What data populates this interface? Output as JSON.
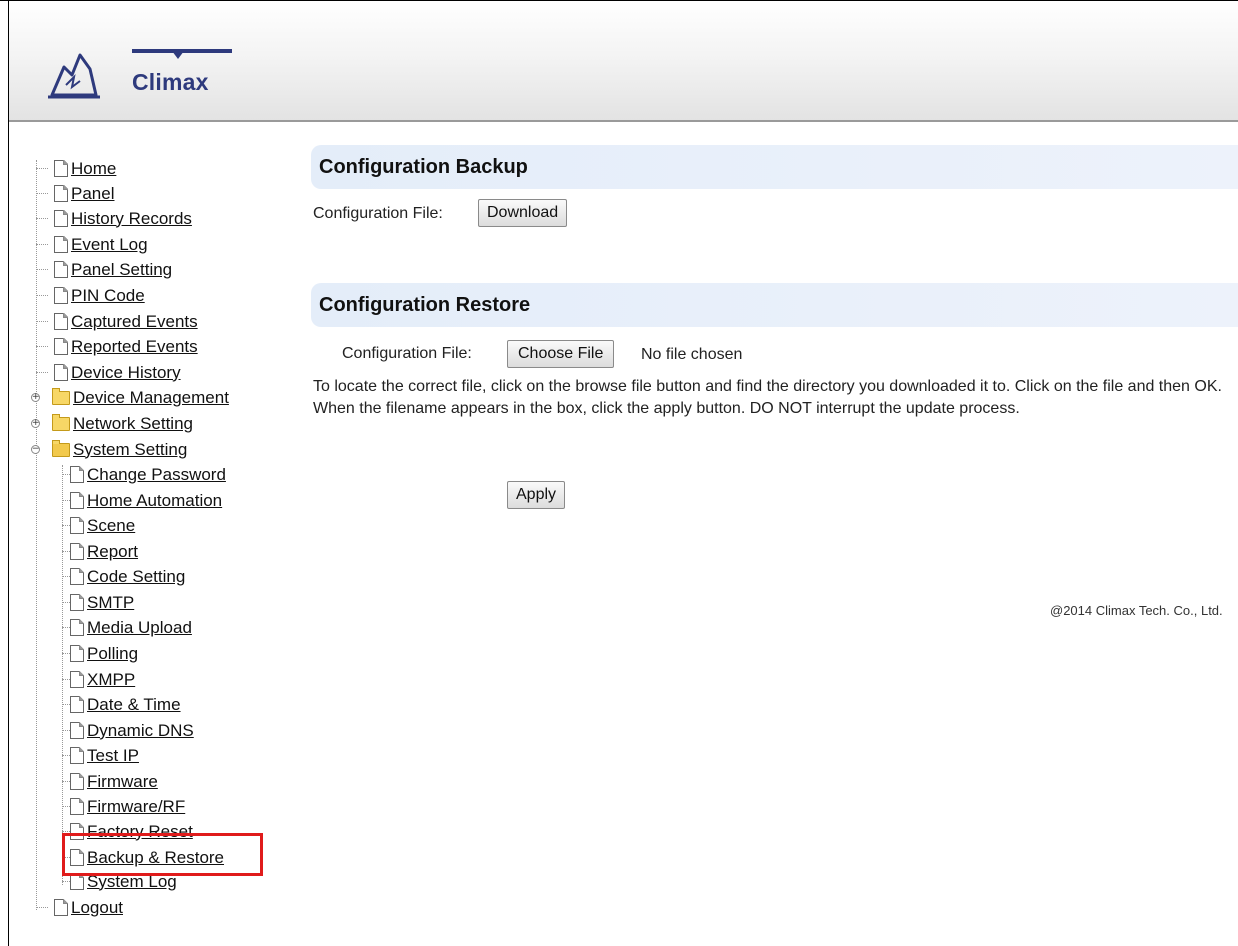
{
  "brand": {
    "logo_text": "Climax"
  },
  "sidebar": {
    "items": [
      {
        "label": "Home"
      },
      {
        "label": "Panel"
      },
      {
        "label": "History Records"
      },
      {
        "label": "Event Log"
      },
      {
        "label": "Panel Setting"
      },
      {
        "label": "PIN Code"
      },
      {
        "label": "Captured Events"
      },
      {
        "label": "Reported Events"
      },
      {
        "label": "Device History"
      },
      {
        "label": "Device Management"
      },
      {
        "label": "Network Setting"
      },
      {
        "label": "System Setting"
      },
      {
        "label": "Logout"
      }
    ],
    "system_children": [
      {
        "label": "Change Password"
      },
      {
        "label": "Home Automation"
      },
      {
        "label": "Scene"
      },
      {
        "label": "Report"
      },
      {
        "label": "Code Setting"
      },
      {
        "label": "SMTP"
      },
      {
        "label": "Media Upload"
      },
      {
        "label": "Polling"
      },
      {
        "label": "XMPP"
      },
      {
        "label": "Date & Time"
      },
      {
        "label": "Dynamic DNS"
      },
      {
        "label": "Test IP"
      },
      {
        "label": "Firmware"
      },
      {
        "label": "Firmware/RF"
      },
      {
        "label": "Factory Reset"
      },
      {
        "label": "Backup & Restore"
      },
      {
        "label": "System Log"
      }
    ],
    "toggles": {
      "collapsed": "+",
      "expanded": "−"
    }
  },
  "backup": {
    "title": "Configuration Backup",
    "file_label": "Configuration File:",
    "download_label": "Download"
  },
  "restore": {
    "title": "Configuration Restore",
    "file_label": "Configuration File:",
    "choose_label": "Choose File",
    "no_file_text": "No file chosen",
    "description": "To locate the correct file, click on the browse file button and find the directory you downloaded it to. Click on the file and then OK. When the filename appears in the box, click the apply button. DO NOT interrupt the update process.",
    "apply_label": "Apply"
  },
  "footer": {
    "copyright": "@2014 Climax Tech. Co., Ltd."
  },
  "colors": {
    "highlight": "#e01b1b",
    "section_bg": "#e4edf9",
    "logo": "#2e3a7d"
  }
}
